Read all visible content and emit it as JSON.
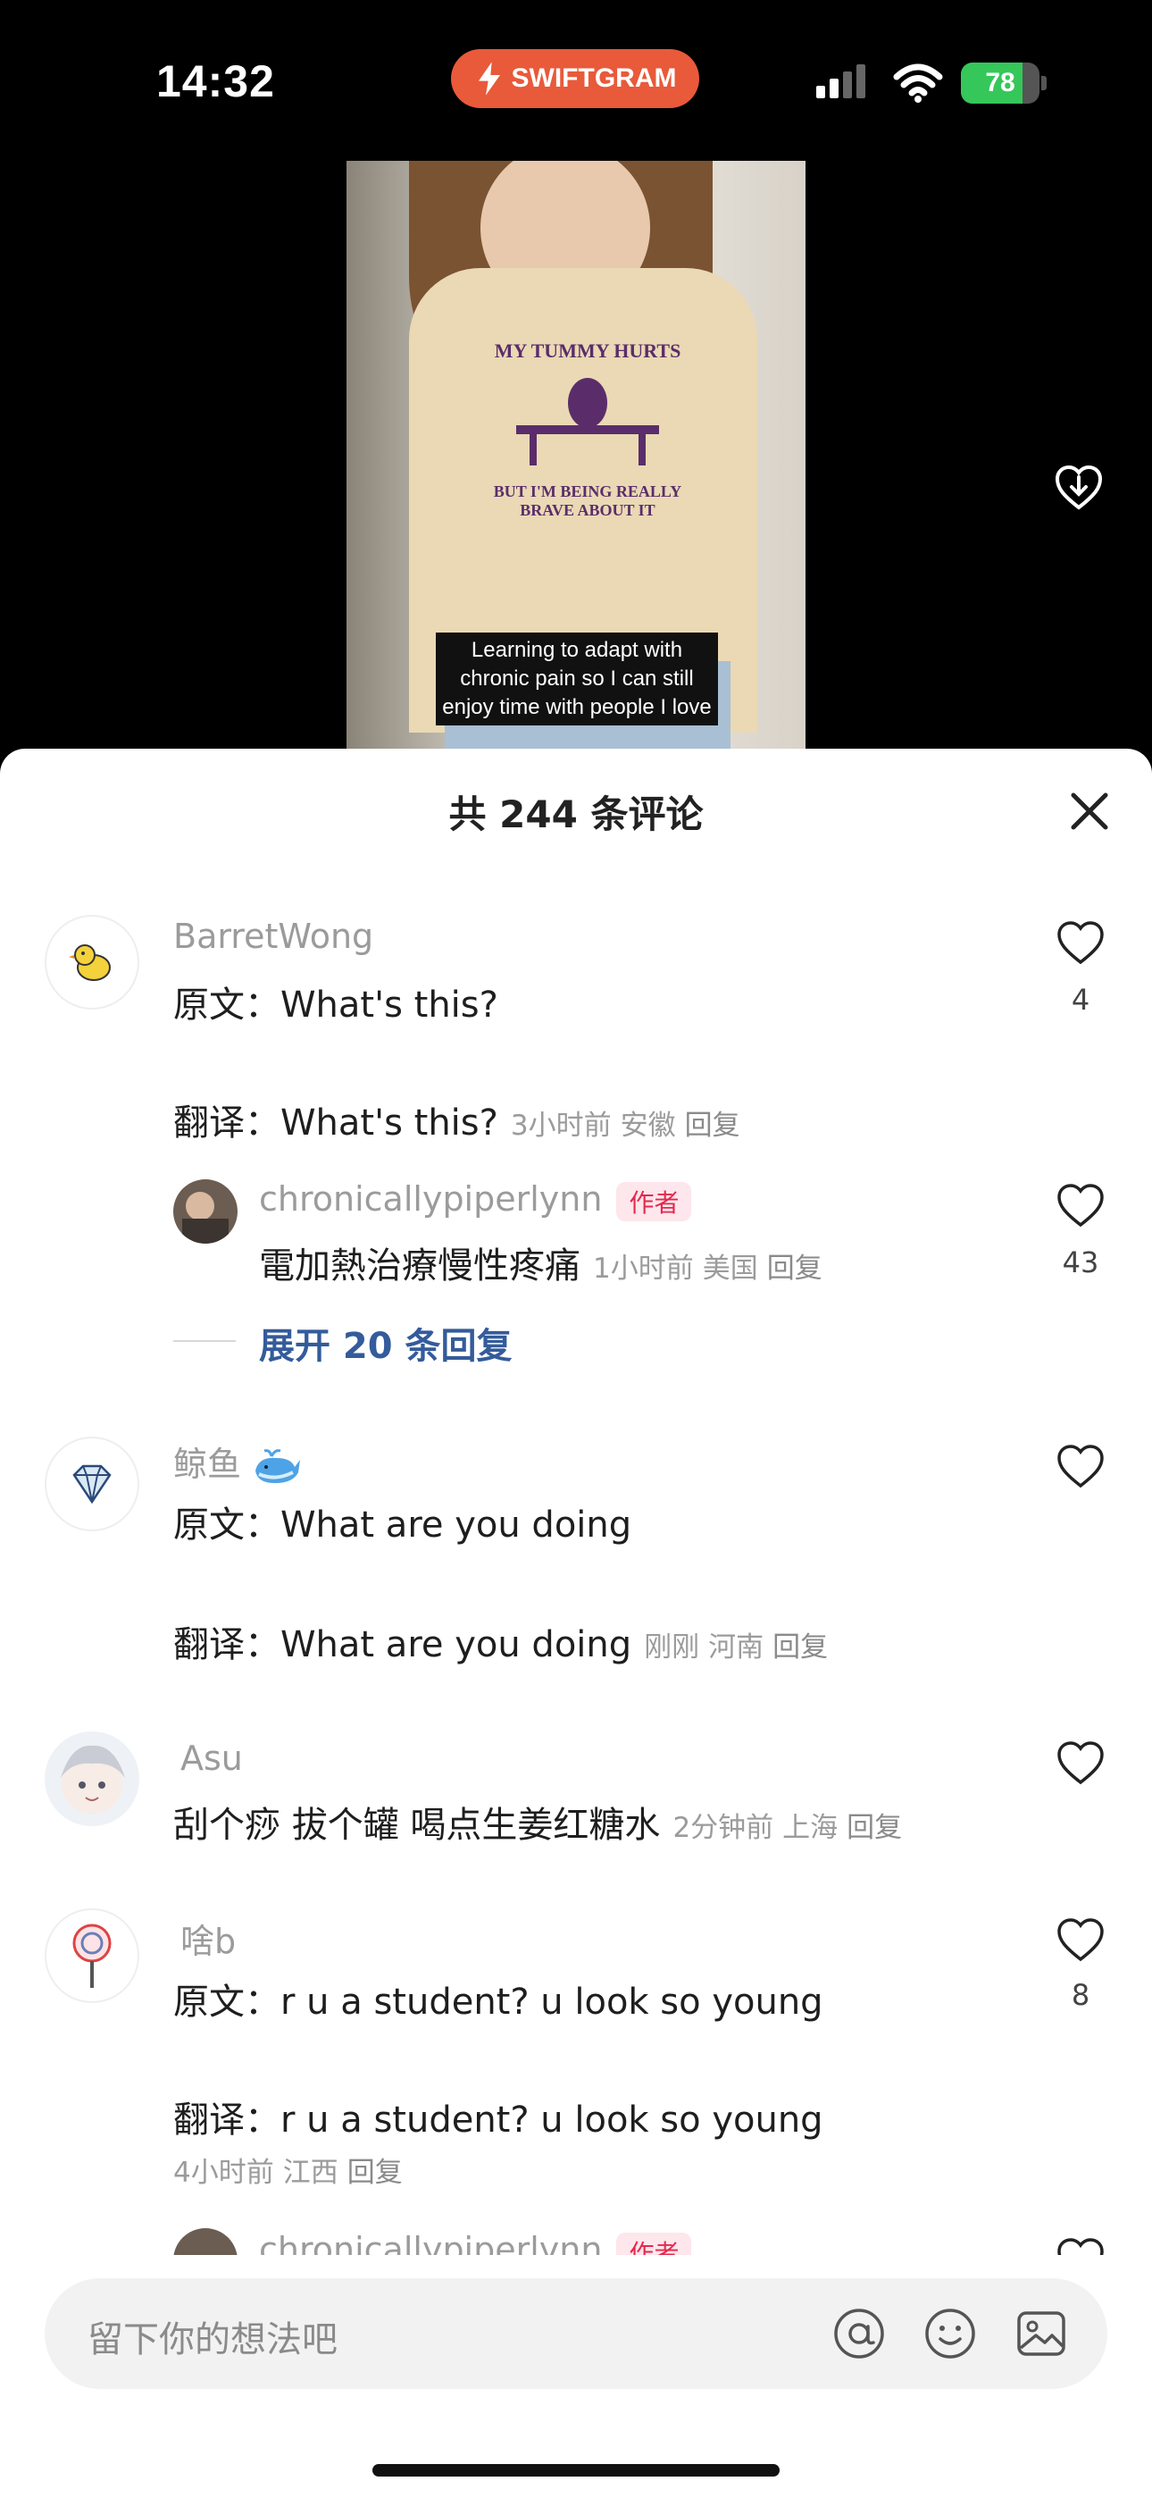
{
  "status": {
    "time": "14:32",
    "app_badge": "SWIFTGRAM",
    "battery": "78",
    "battery_level": 0.78
  },
  "video": {
    "shirt_text_1": "MY TUMMY HURTS",
    "shirt_text_2": "BUT I'M BEING REALLY BRAVE ABOUT IT",
    "caption": "Learning to adapt with chronic pain so I can still enjoy time with people I love"
  },
  "sheet": {
    "title": "共 244 条评论"
  },
  "comments": [
    {
      "user": "BarretWong",
      "original": "原文：What's this?",
      "translation": "翻译：What's this?",
      "time": "3小时前",
      "location": "安徽",
      "reply": "回复",
      "likes": "4"
    },
    {
      "user": "chronicallypiperlynn",
      "tag": "作者",
      "text": "電加熱治療慢性疼痛",
      "time": "1小时前",
      "location": "美国",
      "reply": "回复",
      "likes": "43"
    },
    {
      "expand": "展开 20 条回复"
    },
    {
      "user": "鲸鱼",
      "original": "原文：What are you doing",
      "translation": "翻译：What are you doing",
      "time": "刚刚",
      "location": "河南",
      "reply": "回复"
    },
    {
      "user": "Asu",
      "text": "刮个痧 拔个罐 喝点生姜红糖水",
      "time": "2分钟前",
      "location": "上海",
      "reply": "回复"
    },
    {
      "user": "啥b",
      "original": "原文：r u a student? u look so young",
      "translation": "翻译：r u a student? u look so young",
      "time": "4小时前",
      "location": "江西",
      "reply": "回复",
      "likes": "8"
    },
    {
      "user": "chronicallypiperlynn",
      "tag": "作者"
    }
  ],
  "input": {
    "placeholder": "留下你的想法吧"
  },
  "colors": {
    "accent_badge": "#e85a3a",
    "author_tag": "#e5284d",
    "expand_link": "#345b9b",
    "battery": "#35c759"
  },
  "icons": [
    "swiftgram-bolt-icon",
    "signal-icon",
    "wifi-icon",
    "battery-icon",
    "download-heart-icon",
    "close-icon",
    "heart-icon",
    "at-icon",
    "emoji-icon",
    "image-icon"
  ]
}
